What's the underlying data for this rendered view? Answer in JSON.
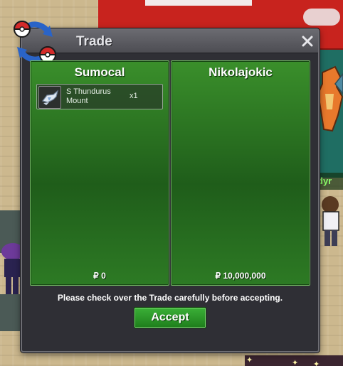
{
  "trade": {
    "title": "Trade",
    "close_glyph": "×",
    "notice": "Please check over the Trade carefully before accepting.",
    "accept_label": "Accept",
    "left": {
      "name": "Sumocal",
      "items": [
        {
          "name": "S Thundurus Mount",
          "qty": "x1",
          "icon": "mount-icon"
        }
      ],
      "money": "₽ 0"
    },
    "right": {
      "name": "Nikolajokic",
      "items": [],
      "money": "₽ 10,000,000"
    }
  },
  "world": {
    "npc_label": "dyr"
  },
  "colors": {
    "panel_green": "#2d7a24",
    "accept_green": "#2b9a28",
    "window_bg": "#2f2f35"
  }
}
